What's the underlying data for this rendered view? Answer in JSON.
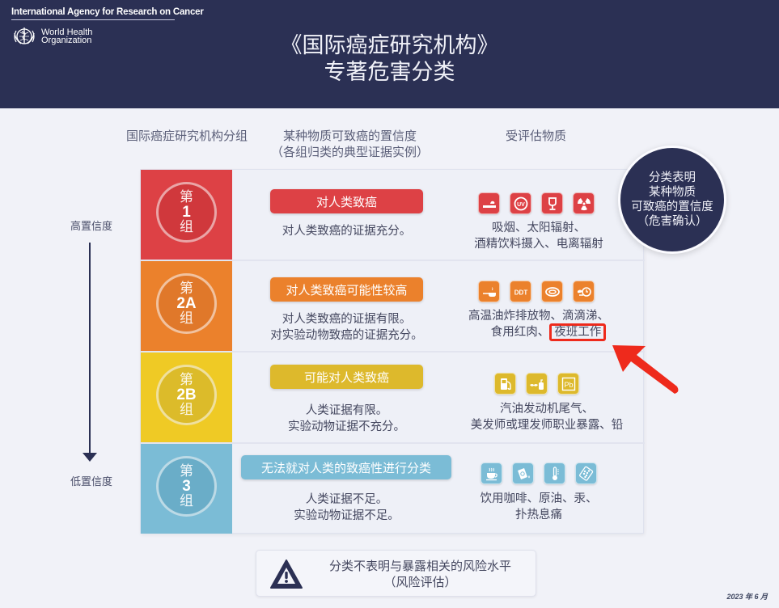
{
  "header": {
    "org_name": "International Agency for Research on Cancer",
    "who_line1": "World Health",
    "who_line2": "Organization",
    "who_logo_icon": "who-emblem-icon",
    "title_line1": "《国际癌症研究机构》",
    "title_line2": "专著危害分类"
  },
  "column_headers": {
    "group": "国际癌症研究机构分组",
    "confidence_line1": "某种物质可致癌的置信度",
    "confidence_line2": "（各组归类的典型证据实例）",
    "agents": "受评估物质"
  },
  "bubble": {
    "lines": [
      "分类表明",
      "某种物质",
      "可致癌的置信度",
      "（危害确认）"
    ],
    "color": "#2b3054"
  },
  "axis": {
    "high": "高置信度",
    "low": "低置信度"
  },
  "groups": [
    {
      "prefix": "第",
      "number": "1",
      "suffix": "组",
      "color": "#dd4145",
      "circle_color": "#d0383c",
      "label": "对人类致癌",
      "evidence": [
        "对人类致癌的证据充分。"
      ],
      "icons": [
        "smoking-icon",
        "uv-radiation-icon",
        "alcohol-glass-icon",
        "radiation-icon"
      ],
      "agents_line1": "吸烟、太阳辐射、",
      "agents_line2": "酒精饮料摄入、电离辐射",
      "agents_highlight": ""
    },
    {
      "prefix": "第",
      "number": "2A",
      "suffix": "组",
      "color": "#eb812c",
      "circle_color": "#e0782a",
      "label": "对人类致癌可能性较高",
      "evidence": [
        "对人类致癌的证据有限。",
        "对实验动物致癌的证据充分。"
      ],
      "icons": [
        "frying-pan-icon",
        "ddt-icon",
        "red-meat-icon",
        "night-shift-icon"
      ],
      "agents_line1": "高温油炸排放物、滴滴涕、",
      "agents_line2": "食用红肉、",
      "agents_highlight": "夜班工作"
    },
    {
      "prefix": "第",
      "number": "2B",
      "suffix": "组",
      "color": "#efca25",
      "circle_color": "#dcbb2a",
      "label": "可能对人类致癌",
      "label_color": "#ddb92c",
      "evidence": [
        "人类证据有限。",
        "实验动物证据不充分。"
      ],
      "icons": [
        "fuel-pump-icon",
        "hairdresser-icon",
        "lead-pb-icon"
      ],
      "agents_line1": "汽油发动机尾气、",
      "agents_line2": "美发师或理发师职业暴露、铅",
      "agents_highlight": ""
    },
    {
      "prefix": "第",
      "number": "3",
      "suffix": "组",
      "color": "#7bbcd6",
      "circle_color": "#6aadc8",
      "label": "无法就对人类的致癌性进行分类",
      "evidence": [
        "人类证据不足。",
        "实验动物证据不足。"
      ],
      "icons": [
        "coffee-cup-icon",
        "crude-oil-icon",
        "thermometer-mercury-icon",
        "pill-pack-icon"
      ],
      "agents_line1": "饮用咖啡、原油、汞、",
      "agents_line2": "扑热息痛",
      "agents_highlight": ""
    }
  ],
  "note": {
    "line1": "分类不表明与暴露相关的风险水平",
    "line2": "（风险评估）",
    "icon": "warning-triangle-icon"
  },
  "date": "2023 年 6 月",
  "annotation": {
    "highlight_color": "#ee2a1c",
    "arrow_icon": "red-pointer-arrow-icon"
  }
}
